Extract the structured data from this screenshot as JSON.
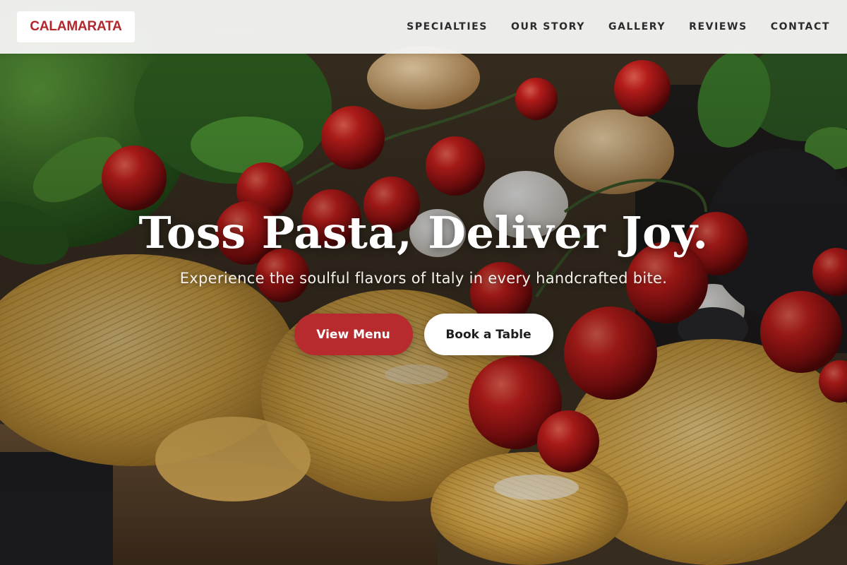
{
  "brand": {
    "name": "CALAMARATA",
    "color": "#b3262b"
  },
  "nav": {
    "items": [
      {
        "label": "SPECIALTIES"
      },
      {
        "label": "OUR STORY"
      },
      {
        "label": "GALLERY"
      },
      {
        "label": "REVIEWS"
      },
      {
        "label": "CONTACT"
      }
    ]
  },
  "hero": {
    "title": "Toss Pasta, Deliver Joy.",
    "subtitle": "Experience the soulful flavors of Italy in every handcrafted bite.",
    "primary_button": "View Menu",
    "secondary_button": "Book a Table",
    "accent_color": "#b72a2e",
    "background_image": "fresh-pasta-nests-tomatoes-basil-photo"
  }
}
